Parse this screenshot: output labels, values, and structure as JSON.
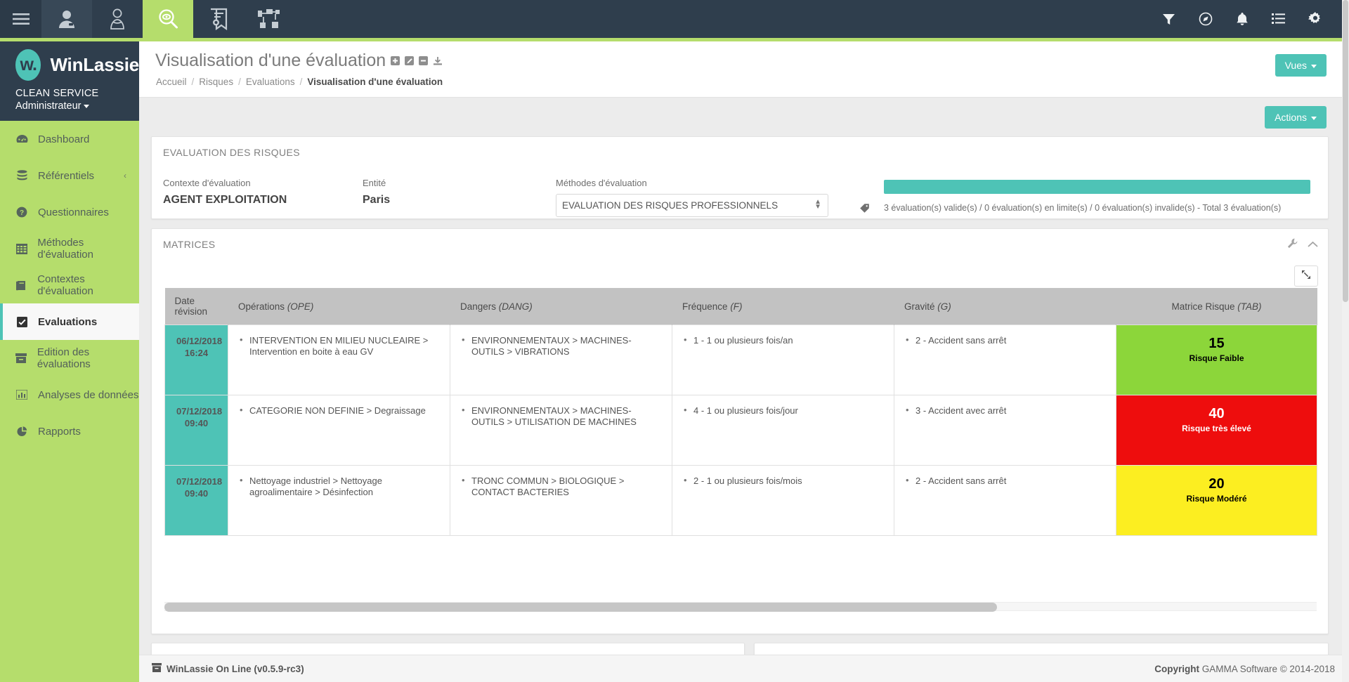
{
  "topbar": {
    "icons": [
      {
        "name": "hamburger-menu-icon",
        "label": "Menu"
      },
      {
        "name": "user-icon",
        "label": "Utilisateurs"
      },
      {
        "name": "injured-person-icon",
        "label": "Accidents"
      },
      {
        "name": "eye-search-icon",
        "label": "Risques"
      },
      {
        "name": "certificate-icon",
        "label": "Formations"
      },
      {
        "name": "org-chart-icon",
        "label": "Organisation"
      }
    ],
    "right_icons": [
      {
        "name": "filter-icon",
        "label": "Filtres"
      },
      {
        "name": "compass-icon",
        "label": "Navigation"
      },
      {
        "name": "bell-icon",
        "label": "Notifications"
      },
      {
        "name": "list-icon",
        "label": "Liste"
      },
      {
        "name": "gear-icon",
        "label": "Paramètres"
      }
    ]
  },
  "sidebar": {
    "brand": "WinLassie",
    "logo_text": "w.",
    "org": "CLEAN SERVICE",
    "user": "Administrateur",
    "items": [
      {
        "label": "Dashboard",
        "icon": "dashboard-icon",
        "active": false
      },
      {
        "label": "Référentiels",
        "icon": "database-icon",
        "active": false,
        "chevron": "‹"
      },
      {
        "label": "Questionnaires",
        "icon": "question-circle-icon",
        "active": false
      },
      {
        "label": "Méthodes d'évaluation",
        "icon": "table-grid-icon",
        "active": false
      },
      {
        "label": "Contextes d'évaluation",
        "icon": "book-icon",
        "active": false
      },
      {
        "label": "Evaluations",
        "icon": "check-square-icon",
        "active": true
      },
      {
        "label": "Edition des évaluations",
        "icon": "archive-icon",
        "active": false
      },
      {
        "label": "Analyses de données",
        "icon": "bar-chart-icon",
        "active": false
      },
      {
        "label": "Rapports",
        "icon": "pie-chart-icon",
        "active": false
      }
    ]
  },
  "header": {
    "title": "Visualisation d'une évaluation",
    "title_actions": [
      {
        "name": "add-icon",
        "label": "Ajouter"
      },
      {
        "name": "edit-pencil-icon",
        "label": "Modifier"
      },
      {
        "name": "remove-icon",
        "label": "Supprimer"
      },
      {
        "name": "download-icon",
        "label": "Télécharger"
      }
    ],
    "breadcrumb": [
      "Accueil",
      "Risques",
      "Evaluations"
    ],
    "breadcrumb_current": "Visualisation d'une évaluation",
    "vues_button": "Vues",
    "actions_button": "Actions"
  },
  "eval_panel": {
    "title": "EVALUATION DES RISQUES",
    "context_label": "Contexte d'évaluation",
    "context_value": "AGENT EXPLOITATION",
    "entity_label": "Entité",
    "entity_value": "Paris",
    "method_label": "Méthodes d'évaluation",
    "method_value": "EVALUATION DES RISQUES PROFESSIONNELS",
    "method_options": [
      "EVALUATION DES RISQUES PROFESSIONNELS"
    ],
    "progress_percent": 100,
    "progress_color": "#4ec3b6",
    "progress_text": "3 évaluation(s) valide(s) / 0 évaluation(s) en limite(s) / 0 évaluation(s) invalide(s) - Total 3 évaluation(s)"
  },
  "matrices_panel": {
    "title": "MATRICES",
    "tools": [
      {
        "name": "wrench-icon",
        "label": "Configurer"
      },
      {
        "name": "chevron-up-icon",
        "label": "Réduire"
      }
    ],
    "expand_button": {
      "name": "expand-arrows-icon",
      "label": "Plein écran"
    },
    "columns": [
      {
        "label": "Date révision",
        "code": ""
      },
      {
        "label": "Opérations",
        "code": "(OPE)"
      },
      {
        "label": "Dangers",
        "code": "(DANG)"
      },
      {
        "label": "Fréquence",
        "code": "(F)"
      },
      {
        "label": "Gravité",
        "code": "(G)"
      },
      {
        "label": "Matrice Risque",
        "code": "(TAB)"
      }
    ],
    "rows": [
      {
        "date": "06/12/2018",
        "time": "16:24",
        "operations": [
          "INTERVENTION EN MILIEU NUCLEAIRE > Intervention en boite à eau GV"
        ],
        "dangers": [
          "ENVIRONNEMENTAUX > MACHINES-OUTILS > VIBRATIONS"
        ],
        "frequence": [
          "1 - 1 ou plusieurs fois/an"
        ],
        "gravite": [
          "2 - Accident sans arrêt"
        ],
        "risk_value": "15",
        "risk_label": "Risque Faible",
        "risk_bg": "#8cd63a",
        "risk_fg": "#000000"
      },
      {
        "date": "07/12/2018",
        "time": "09:40",
        "operations": [
          "CATEGORIE NON DEFINIE > Degraissage"
        ],
        "dangers": [
          "ENVIRONNEMENTAUX > MACHINES-OUTILS > UTILISATION DE MACHINES"
        ],
        "frequence": [
          "4 - 1 ou plusieurs fois/jour"
        ],
        "gravite": [
          "3 - Accident avec arrêt"
        ],
        "risk_value": "40",
        "risk_label": "Risque très élevé",
        "risk_bg": "#ee0d0d",
        "risk_fg": "#ffffff"
      },
      {
        "date": "07/12/2018",
        "time": "09:40",
        "operations": [
          "Nettoyage industriel > Nettoyage agroalimentaire > Désinfection"
        ],
        "dangers": [
          "TRONC COMMUN > BIOLOGIQUE > CONTACT BACTERIES"
        ],
        "frequence": [
          "2 - 1 ou plusieurs fois/mois"
        ],
        "gravite": [
          "2 - Accident sans arrêt"
        ],
        "risk_value": "20",
        "risk_label": "Risque Modéré",
        "risk_bg": "#fcee21",
        "risk_fg": "#000000"
      }
    ]
  },
  "footer": {
    "left": "WinLassie On Line (v0.5.9-rc3)",
    "copyright_bold": "Copyright",
    "copyright_rest": " GAMMA Software © 2014-2018"
  }
}
